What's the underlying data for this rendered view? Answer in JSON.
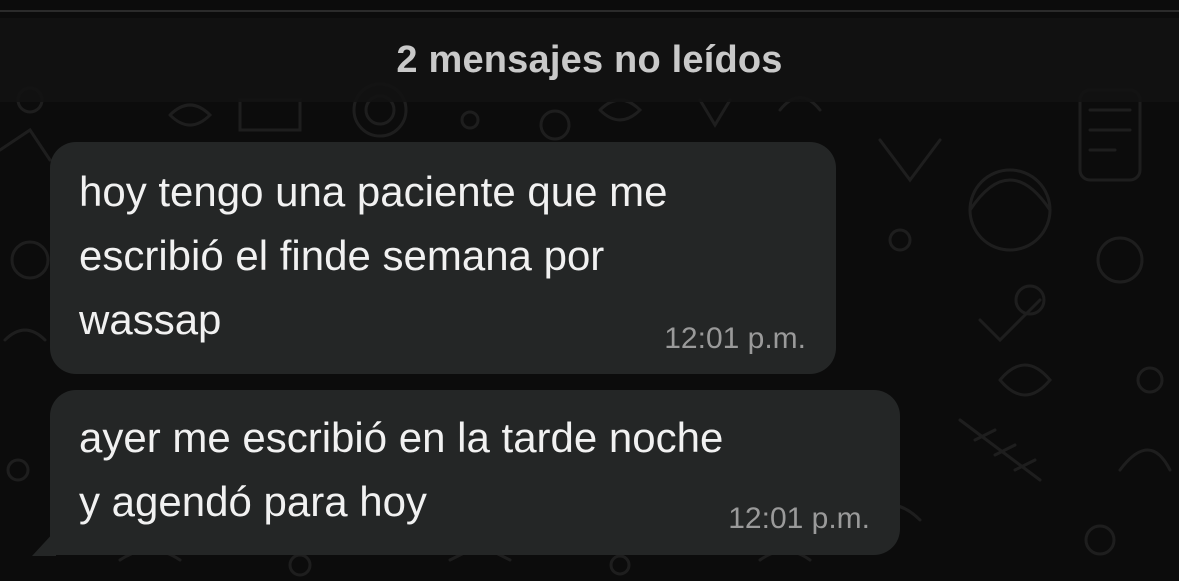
{
  "chat": {
    "unread_banner": "2 mensajes no leídos",
    "messages": [
      {
        "text": "hoy tengo una paciente que me\nescribió el finde semana por\nwassap",
        "time": "12:01 p.m."
      },
      {
        "text": "ayer me escribió en la tarde noche\ny agendó para hoy",
        "time": "12:01 p.m."
      }
    ],
    "colors": {
      "background": "#0c0c0c",
      "bubble": "#242626",
      "text": "#f1f1f1",
      "time": "#9a9a9a",
      "banner_text": "#c9c9c9"
    }
  }
}
